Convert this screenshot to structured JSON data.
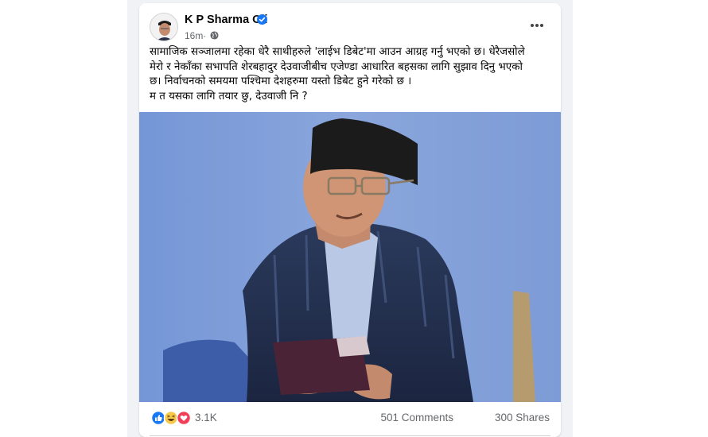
{
  "post": {
    "author": "K P Sharma Oli",
    "time": "16m",
    "separator": "·",
    "text_lines": [
      "सामाजिक सञ्जालमा रहेका धेरै साथीहरुले 'लाईभ डिबेट'मा आउन आग्रह गर्नु भएको छ। धेरैजसोले",
      "मेरो र नेकाँका सभापति शेरबहादुर देउवाजीबीच एजेण्डा आधारित बहसका लागि सुझाव दिनु भएको",
      "छ। निर्वाचनको समयमा पश्चिमा देशहरुमा यस्तो डिबेट हुने गरेको छ ।",
      "म त यसका लागि तयार छु, देउवाजी नि ?"
    ]
  },
  "reactions": {
    "count": "3.1K",
    "types": [
      "like-icon",
      "haha-icon",
      "love-icon"
    ],
    "comments": "501 Comments",
    "shares": "300 Shares"
  },
  "colors": {
    "brand_blue": "#1877f2",
    "photo_background": "#7e9fd9",
    "secondary_text": "#65676b"
  }
}
